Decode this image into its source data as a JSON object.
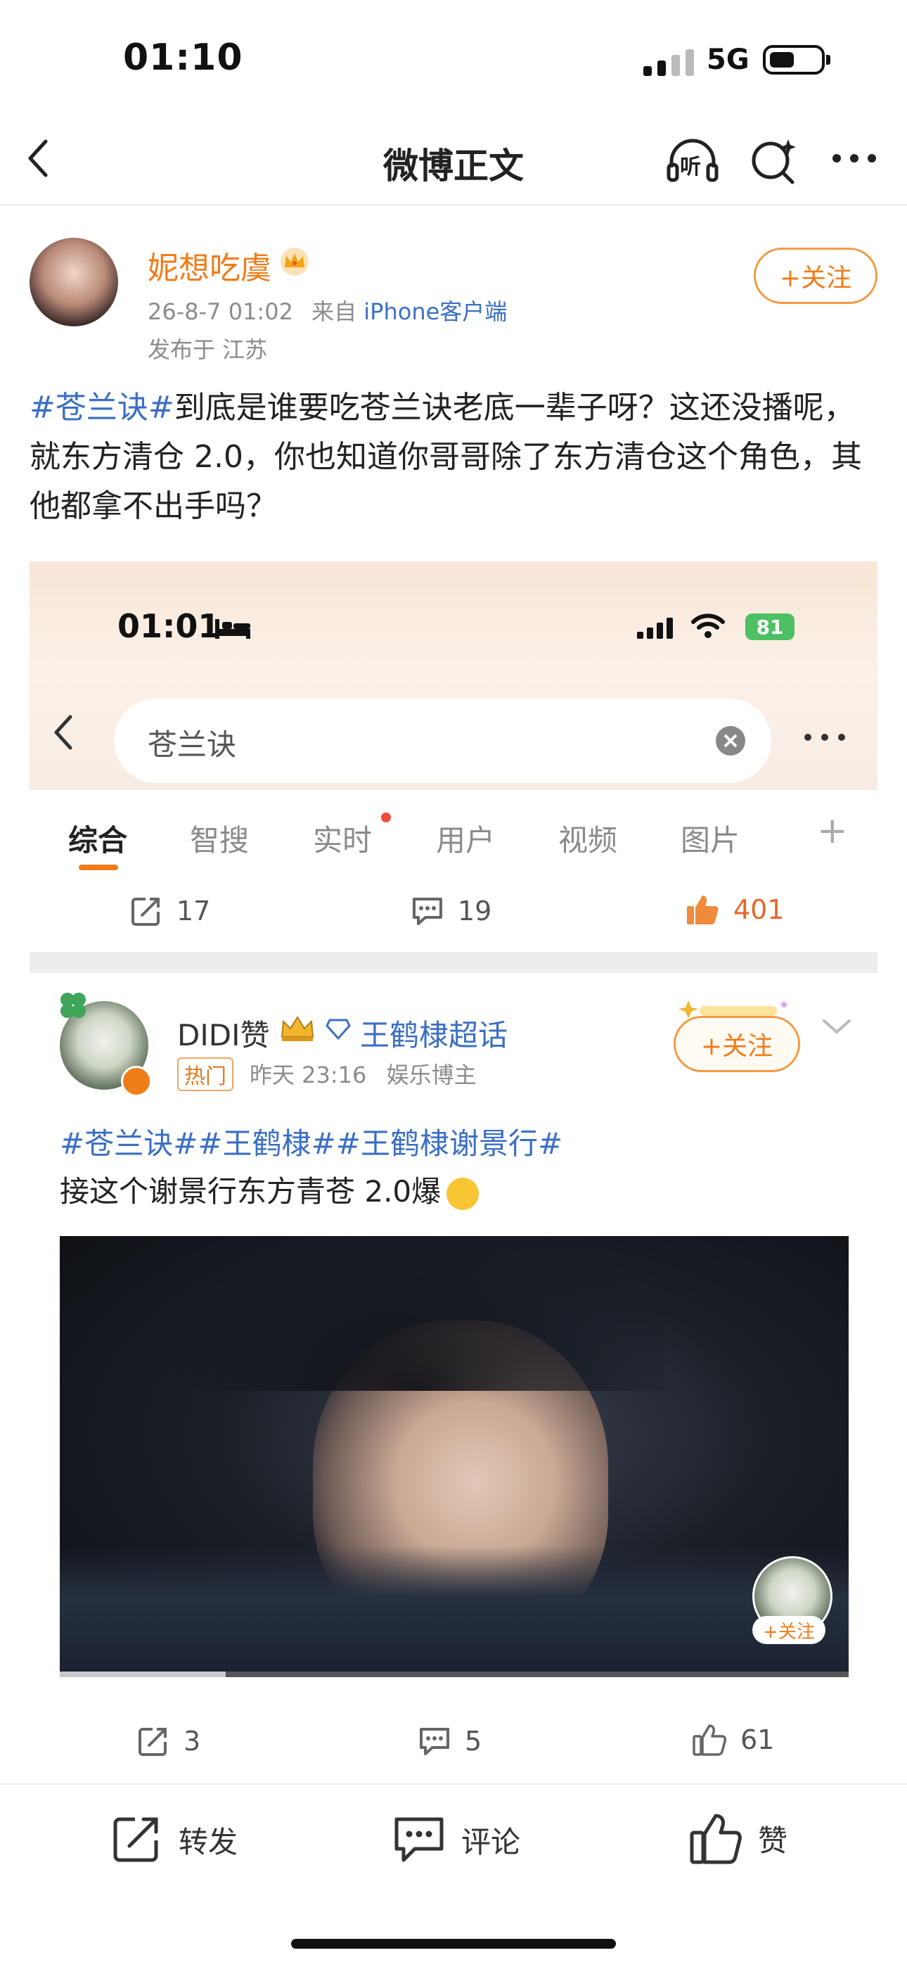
{
  "status_bar": {
    "time": "01:10",
    "network": "5G"
  },
  "nav": {
    "title": "微博正文",
    "listen_label": "听"
  },
  "post": {
    "author": "妮想吃虞",
    "timestamp": "26-8-7 01:02",
    "source_prefix": "来自",
    "source": "iPhone客户端",
    "location": "发布于 江苏",
    "follow_label": "+关注",
    "text_tag": "#苍兰诀#",
    "text_body": "到底是谁要吃苍兰诀老底一辈子呀？这还没播呢，就东方清仓 2.0，你也知道你哥哥除了东方清仓这个角色，其他都拿不出手吗？"
  },
  "embedded": {
    "time": "01:01",
    "battery": "81",
    "search_query": "苍兰诀",
    "tabs": [
      "综合",
      "智搜",
      "实时",
      "用户",
      "视频",
      "图片",
      "+"
    ],
    "counts": {
      "reposts": "17",
      "comments": "19",
      "likes": "401"
    },
    "post": {
      "author": "DIDI赞",
      "supertopic": "王鹤棣超话",
      "badge": "热门",
      "time": "昨天 23:16",
      "role": "娱乐博主",
      "follow_label": "+关注",
      "tags": "#苍兰诀##王鹤棣##王鹤棣谢景行#",
      "text": "接这个谢景行东方青苍 2.0爆",
      "video_follow": "+关注",
      "video_progress": 0.21
    },
    "counts2": {
      "reposts": "3",
      "comments": "5",
      "likes": "61"
    }
  },
  "bottom_bar": {
    "repost": "转发",
    "comment": "评论",
    "like": "赞"
  },
  "colors": {
    "accent": "#f07c1a",
    "link": "#3b6fc4",
    "like": "#e8672a"
  }
}
